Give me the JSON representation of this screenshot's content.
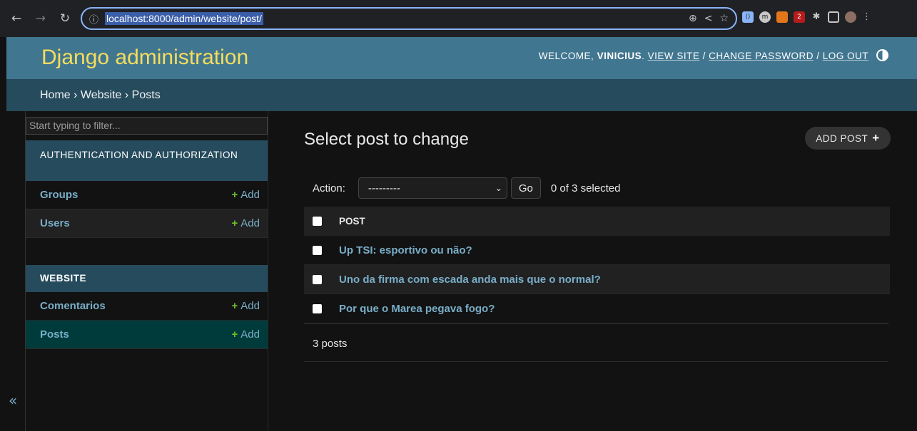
{
  "browser": {
    "url": "localhost:8000/admin/website/post/",
    "ext_badge": "2"
  },
  "header": {
    "brand": "Django administration",
    "welcome": "WELCOME,",
    "username": "VINICIUS",
    "view_site": "VIEW SITE",
    "change_password": "CHANGE PASSWORD",
    "log_out": "LOG OUT",
    "sep": "/"
  },
  "breadcrumbs": {
    "home": "Home",
    "app": "Website",
    "current": "Posts",
    "sep": "›"
  },
  "sidebar": {
    "filter_placeholder": "Start typing to filter...",
    "modules": [
      {
        "caption": "AUTHENTICATION AND AUTHORIZATION",
        "models": [
          {
            "name": "Groups",
            "add": "Add"
          },
          {
            "name": "Users",
            "add": "Add"
          }
        ]
      },
      {
        "caption": "WEBSITE",
        "models": [
          {
            "name": "Comentarios",
            "add": "Add"
          },
          {
            "name": "Posts",
            "add": "Add"
          }
        ]
      }
    ],
    "toggle": "«"
  },
  "content": {
    "title": "Select post to change",
    "add_button": "ADD POST",
    "action_label": "Action:",
    "action_selected": "---------",
    "go": "Go",
    "selected_count": "0 of 3 selected",
    "column_header": "POST",
    "rows": [
      "Up TSI: esportivo ou não?",
      "Uno da firma com escada anda mais que o normal?",
      "Por que o Marea pegava fogo?"
    ],
    "paginator": "3 posts"
  },
  "colors": {
    "header_bg": "#417690",
    "breadcrumb_bg": "#264b5d",
    "brand": "#f5dd5d",
    "link": "#79aec8",
    "add_plus": "#70bf2b",
    "selected_row": "#003b3b"
  }
}
